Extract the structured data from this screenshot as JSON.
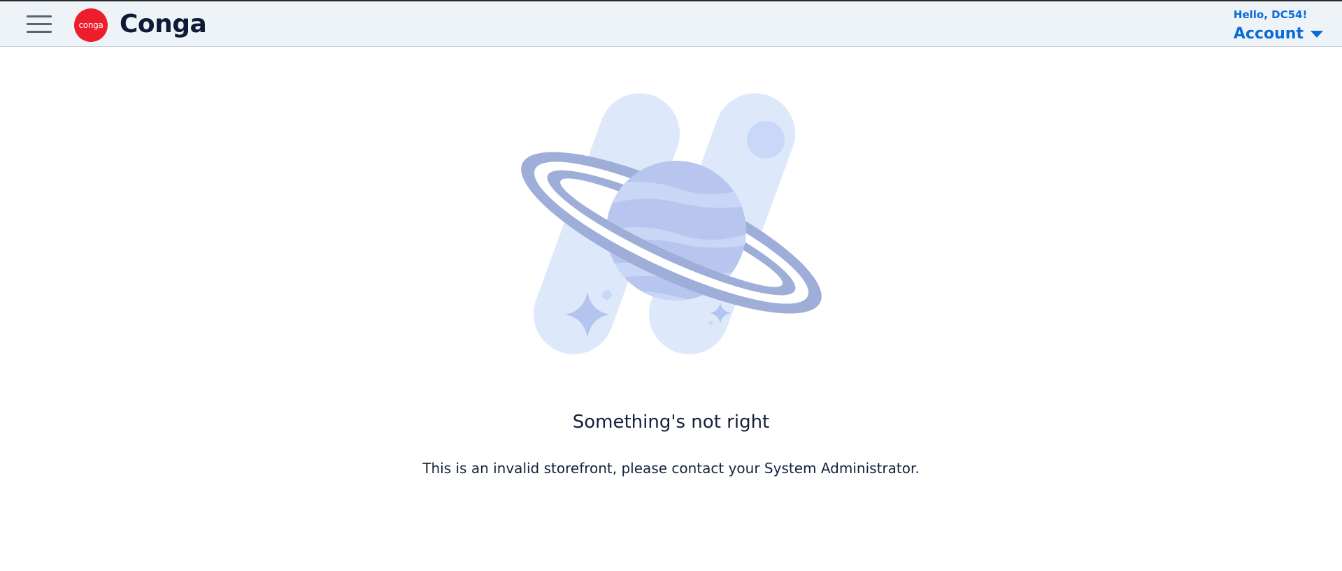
{
  "header": {
    "brand_badge": "conga",
    "brand_name": "Conga",
    "greeting": "Hello, DC54!",
    "account_label": "Account",
    "background_color": "#eef3f8",
    "accent_color": "#0b6bd6",
    "badge_color": "#ee1d2c"
  },
  "icons": {
    "menu": "hamburger-menu-icon",
    "account_dropdown": "caret-down-icon",
    "illustration": "planet-with-rings-illustration"
  },
  "error": {
    "title": "Something's not right",
    "message": "This is an invalid storefront, please contact your System Administrator."
  }
}
